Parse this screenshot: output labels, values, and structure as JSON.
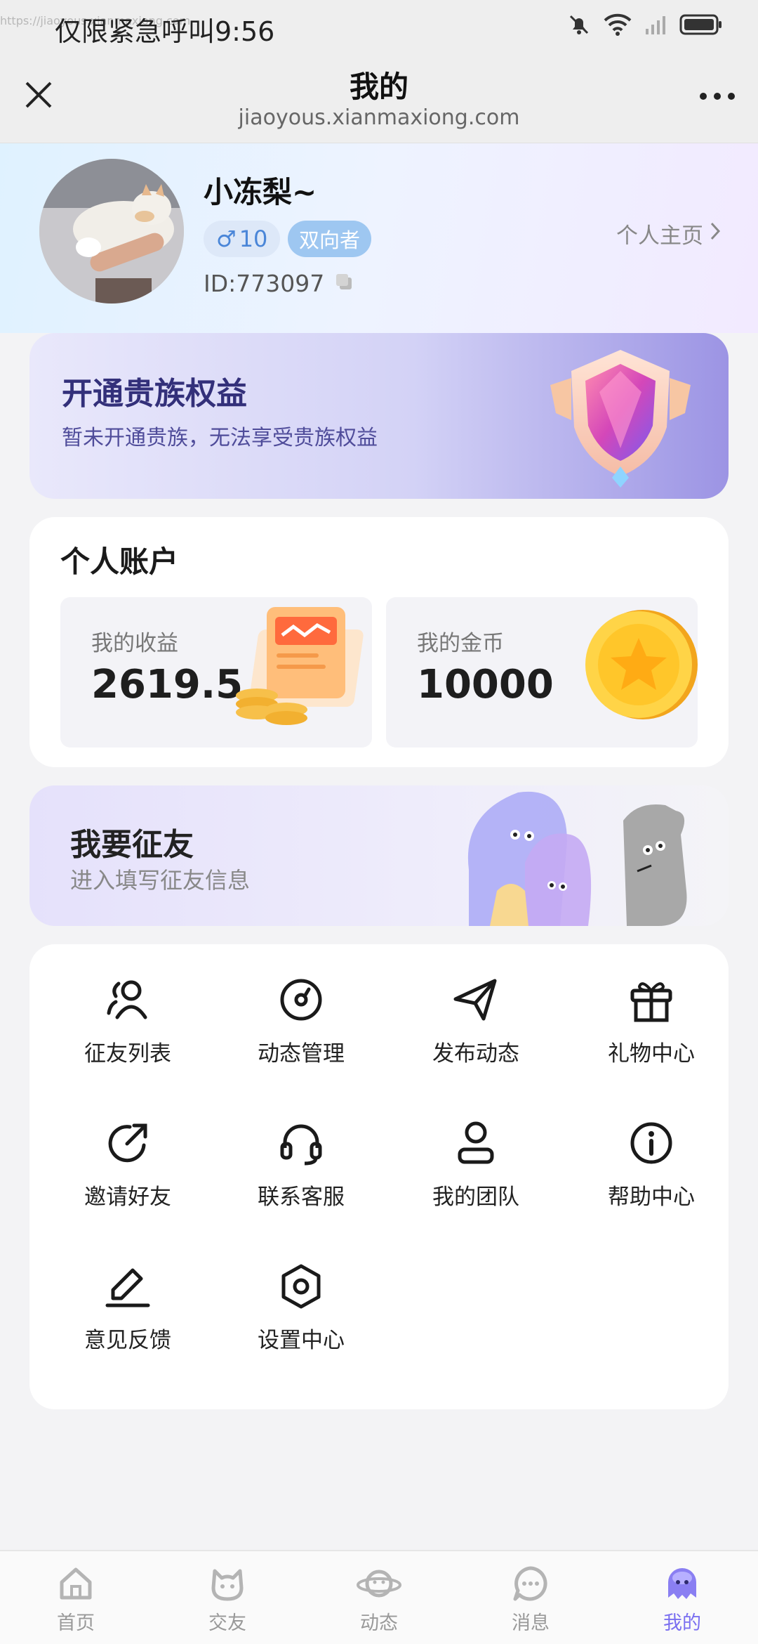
{
  "status_bar": {
    "carrier_time": "仅限紧急呼叫9:56",
    "url_ghost": "https://jiaoyous.xianmaxiong.com"
  },
  "nav": {
    "title": "我的",
    "url": "jiaoyous.xianmaxiong.com"
  },
  "profile": {
    "nickname": "小冻梨~",
    "gender_symbol": "♂",
    "level": "10",
    "role_badge": "双向者",
    "user_id": "ID:773097",
    "homepage_link": "个人主页"
  },
  "vip": {
    "title": "开通贵族权益",
    "subtitle": "暂未开通贵族，无法享受贵族权益"
  },
  "account": {
    "title": "个人账户",
    "earnings_label": "我的收益",
    "earnings_value": "2619.5",
    "coins_label": "我的金币",
    "coins_value": "10000"
  },
  "friend_banner": {
    "title": "我要征友",
    "subtitle": "进入填写征友信息"
  },
  "functions": [
    {
      "label": "征友列表",
      "icon": "users-icon"
    },
    {
      "label": "动态管理",
      "icon": "disc-icon"
    },
    {
      "label": "发布动态",
      "icon": "send-icon"
    },
    {
      "label": "礼物中心",
      "icon": "gift-icon"
    },
    {
      "label": "邀请好友",
      "icon": "share-arrow-icon"
    },
    {
      "label": "联系客服",
      "icon": "headset-icon"
    },
    {
      "label": "我的团队",
      "icon": "person-icon"
    },
    {
      "label": "帮助中心",
      "icon": "info-icon"
    },
    {
      "label": "意见反馈",
      "icon": "edit-icon"
    },
    {
      "label": "设置中心",
      "icon": "settings-hex-icon"
    }
  ],
  "tabs": [
    {
      "label": "首页",
      "icon": "home-icon",
      "active": false
    },
    {
      "label": "交友",
      "icon": "cat-icon",
      "active": false
    },
    {
      "label": "动态",
      "icon": "planet-icon",
      "active": false
    },
    {
      "label": "消息",
      "icon": "chat-icon",
      "active": false
    },
    {
      "label": "我的",
      "icon": "ghost-icon",
      "active": true
    }
  ],
  "colors": {
    "accent": "#7a6ff0",
    "vip_title": "#33307a",
    "role_badge": "#9ec7f1"
  }
}
